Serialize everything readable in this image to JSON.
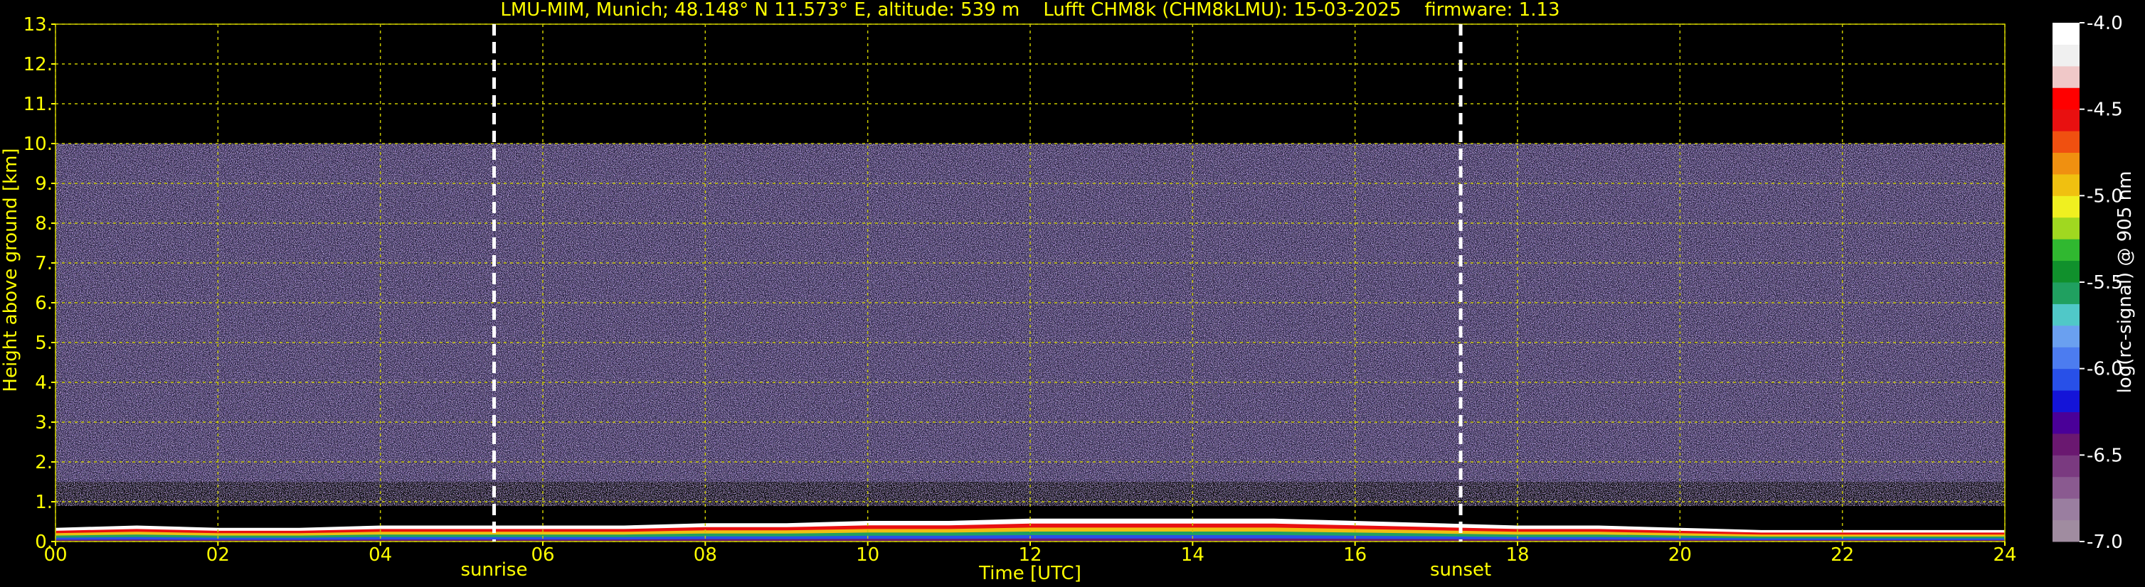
{
  "title": "LMU-MIM, Munich; 48.148° N 11.573° E, altitude: 539 m    Lufft CHM8k (CHM8kLMU): 15-03-2025    firmware: 1.13",
  "colors": {
    "text": "#ffff00",
    "grid": "#c8c800",
    "background": "#000000",
    "marker": "#ffffff"
  },
  "chart_data": {
    "type": "heatmap",
    "title": "LMU-MIM, Munich; 48.148° N 11.573° E, altitude: 539 m    Lufft CHM8k (CHM8kLMU): 15-03-2025    firmware: 1.13",
    "xlabel": "Time [UTC]",
    "ylabel": "Height above ground [km]",
    "xlim": [
      0,
      24
    ],
    "ylim": [
      0,
      13
    ],
    "x_ticks": [
      "00",
      "02",
      "04",
      "06",
      "08",
      "10",
      "12",
      "14",
      "16",
      "18",
      "20",
      "22",
      "24"
    ],
    "y_ticks": [
      "0.",
      "1.",
      "2.",
      "3.",
      "4.",
      "5.",
      "6.",
      "7.",
      "8.",
      "9.",
      "10.",
      "11.",
      "12.",
      "13."
    ],
    "grid": true,
    "signal_top_km": 10,
    "markers": [
      {
        "label": "sunrise",
        "time": 5.4
      },
      {
        "label": "sunset",
        "time": 17.3
      }
    ],
    "boundary_layer_km": [
      [
        0,
        0.3
      ],
      [
        1,
        0.35
      ],
      [
        2,
        0.3
      ],
      [
        3,
        0.3
      ],
      [
        4,
        0.35
      ],
      [
        5,
        0.35
      ],
      [
        6,
        0.35
      ],
      [
        7,
        0.35
      ],
      [
        8,
        0.4
      ],
      [
        9,
        0.4
      ],
      [
        10,
        0.45
      ],
      [
        11,
        0.45
      ],
      [
        12,
        0.5
      ],
      [
        13,
        0.5
      ],
      [
        14,
        0.5
      ],
      [
        15,
        0.5
      ],
      [
        16,
        0.45
      ],
      [
        17,
        0.4
      ],
      [
        18,
        0.35
      ],
      [
        19,
        0.35
      ],
      [
        20,
        0.3
      ],
      [
        21,
        0.25
      ],
      [
        22,
        0.25
      ],
      [
        23,
        0.25
      ],
      [
        24,
        0.25
      ]
    ],
    "colorbar": {
      "label": "log(rc-signal) @ 905 nm",
      "min": -7.0,
      "max": -4.0,
      "tick_labels": [
        "-4.0",
        "-4.5",
        "-5.0",
        "-5.5",
        "-6.0",
        "-6.5",
        "-7.0"
      ],
      "colors": [
        "#a08ca0",
        "#9a7ea0",
        "#8a5a90",
        "#7a3a80",
        "#6a1870",
        "#4a0098",
        "#1414d8",
        "#2850e8",
        "#4c7cf0",
        "#6aa0f0",
        "#50c8c8",
        "#20a060",
        "#10902c",
        "#30b830",
        "#a0d820",
        "#f0f020",
        "#f0c010",
        "#f09010",
        "#f05010",
        "#e81010",
        "#ff0000",
        "#f0c8c8",
        "#f0f0f0",
        "#ffffff"
      ]
    }
  }
}
